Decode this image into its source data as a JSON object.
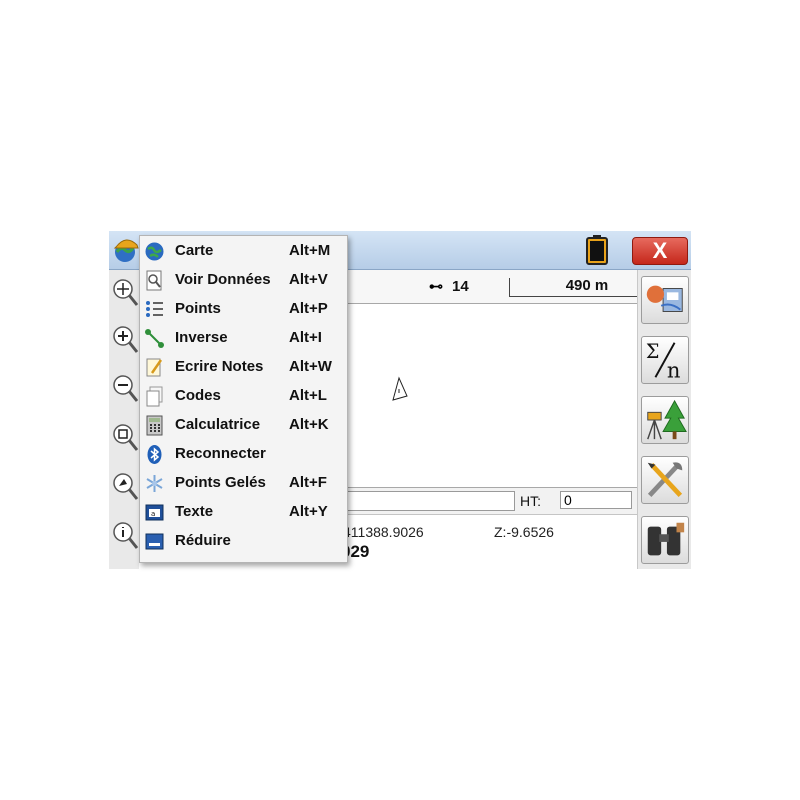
{
  "status": {
    "satellites": "14",
    "scale": "490 m"
  },
  "stakeout": {
    "ht_label": "HT:",
    "ht_value": "0",
    "y_readout": "411388.9026",
    "z_readout": "Z:-9.6526",
    "point_number": "029"
  },
  "titlebar": {
    "close_label": "X"
  },
  "menu": {
    "items": [
      {
        "label": "Carte",
        "shortcut": "Alt+M",
        "icon": "globe-icon"
      },
      {
        "label": "Voir Données",
        "shortcut": "Alt+V",
        "icon": "magnifier-doc-icon"
      },
      {
        "label": "Points",
        "shortcut": "Alt+P",
        "icon": "point-list-icon"
      },
      {
        "label": "Inverse",
        "shortcut": "Alt+I",
        "icon": "inverse-line-icon"
      },
      {
        "label": "Ecrire Notes",
        "shortcut": "Alt+W",
        "icon": "notepad-pencil-icon"
      },
      {
        "label": "Codes",
        "shortcut": "Alt+L",
        "icon": "pages-icon"
      },
      {
        "label": "Calculatrice",
        "shortcut": "Alt+K",
        "icon": "calculator-icon"
      },
      {
        "label": "Reconnecter",
        "shortcut": "",
        "icon": "bluetooth-icon"
      },
      {
        "label": "Points Gelés",
        "shortcut": "Alt+F",
        "icon": "frozen-points-icon"
      },
      {
        "label": "Texte",
        "shortcut": "Alt+Y",
        "icon": "text-window-icon"
      },
      {
        "label": "Réduire",
        "shortcut": "",
        "icon": "minimize-icon"
      }
    ]
  },
  "colors": {
    "titlebar": "#c5d9ef",
    "close_button": "#d2382b",
    "menu_background": "#f4f4f4"
  }
}
